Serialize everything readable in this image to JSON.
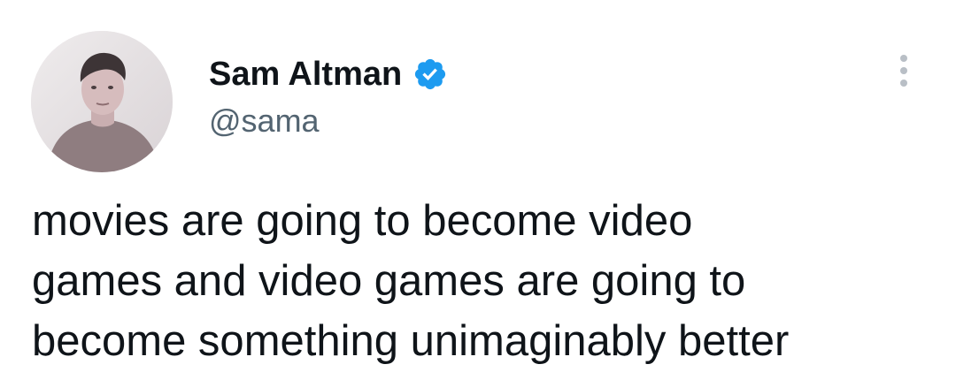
{
  "author": {
    "display_name": "Sam Altman",
    "handle": "@sama",
    "verified": true,
    "avatar_icon": "profile-photo",
    "verified_icon": "verified-badge-icon"
  },
  "actions": {
    "more_icon": "more-vertical-icon"
  },
  "tweet": {
    "lines": [
      "movies are going to become video",
      "games and video games are going to",
      "become something unimaginably better"
    ]
  },
  "colors": {
    "background": "#ffffff",
    "text": "#0f1419",
    "secondary_text": "#536471",
    "verified_blue": "#1d9bf0",
    "icon_gray": "#b9bfc6"
  }
}
